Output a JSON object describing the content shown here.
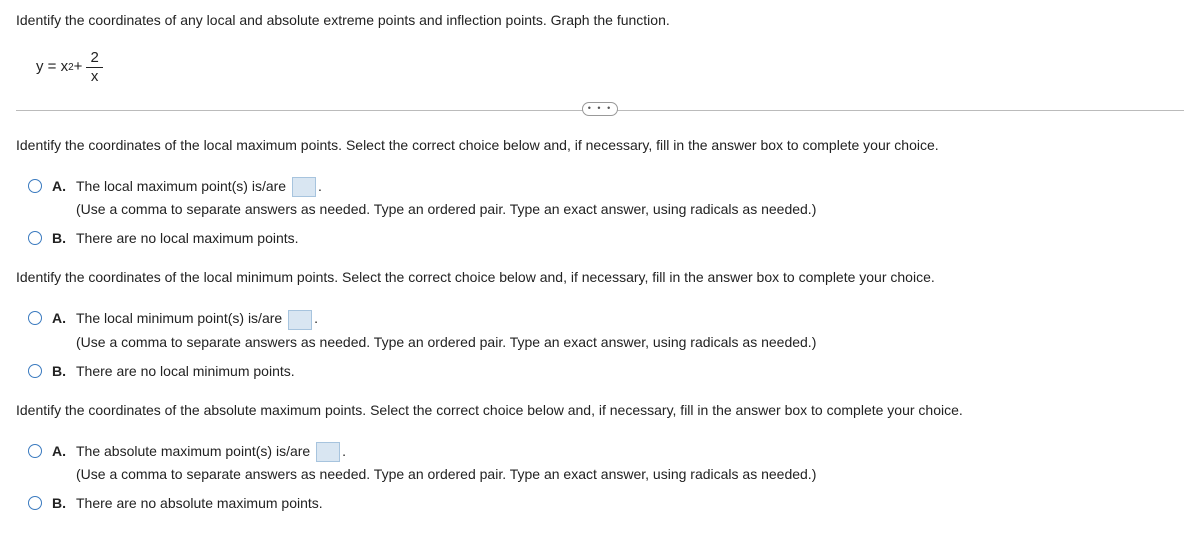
{
  "header": "Identify the coordinates of any local and absolute extreme points and inflection points. Graph the function.",
  "equation": {
    "lhs": "y = x",
    "exp": "2",
    "plus": " + ",
    "num": "2",
    "den": "x"
  },
  "ellipsis": "• • •",
  "q1": {
    "prompt": "Identify the coordinates of the local maximum points. Select the correct choice below and, if necessary, fill in the answer box to complete your choice.",
    "optA_letter": "A.",
    "optA_textPrefix": "The local maximum point(s) is/are ",
    "optA_textSuffix": ".",
    "optA_instruction": "(Use a comma to separate answers as needed. Type an ordered pair. Type an exact answer, using radicals as needed.)",
    "optB_letter": "B.",
    "optB_text": "There are no local maximum points."
  },
  "q2": {
    "prompt": "Identify the coordinates of the local minimum points. Select the correct choice below and, if necessary, fill in the answer box to complete your choice.",
    "optA_letter": "A.",
    "optA_textPrefix": "The local minimum point(s) is/are ",
    "optA_textSuffix": ".",
    "optA_instruction": "(Use a comma to separate answers as needed. Type an ordered pair. Type an exact answer, using radicals as needed.)",
    "optB_letter": "B.",
    "optB_text": "There are no local minimum points."
  },
  "q3": {
    "prompt": "Identify the coordinates of the absolute maximum points. Select the correct choice below and, if necessary, fill in the answer box to complete your choice.",
    "optA_letter": "A.",
    "optA_textPrefix": "The absolute maximum point(s) is/are ",
    "optA_textSuffix": ".",
    "optA_instruction": "(Use a comma to separate answers as needed. Type an ordered pair. Type an exact answer, using radicals as needed.)",
    "optB_letter": "B.",
    "optB_text": "There are no absolute maximum points."
  }
}
